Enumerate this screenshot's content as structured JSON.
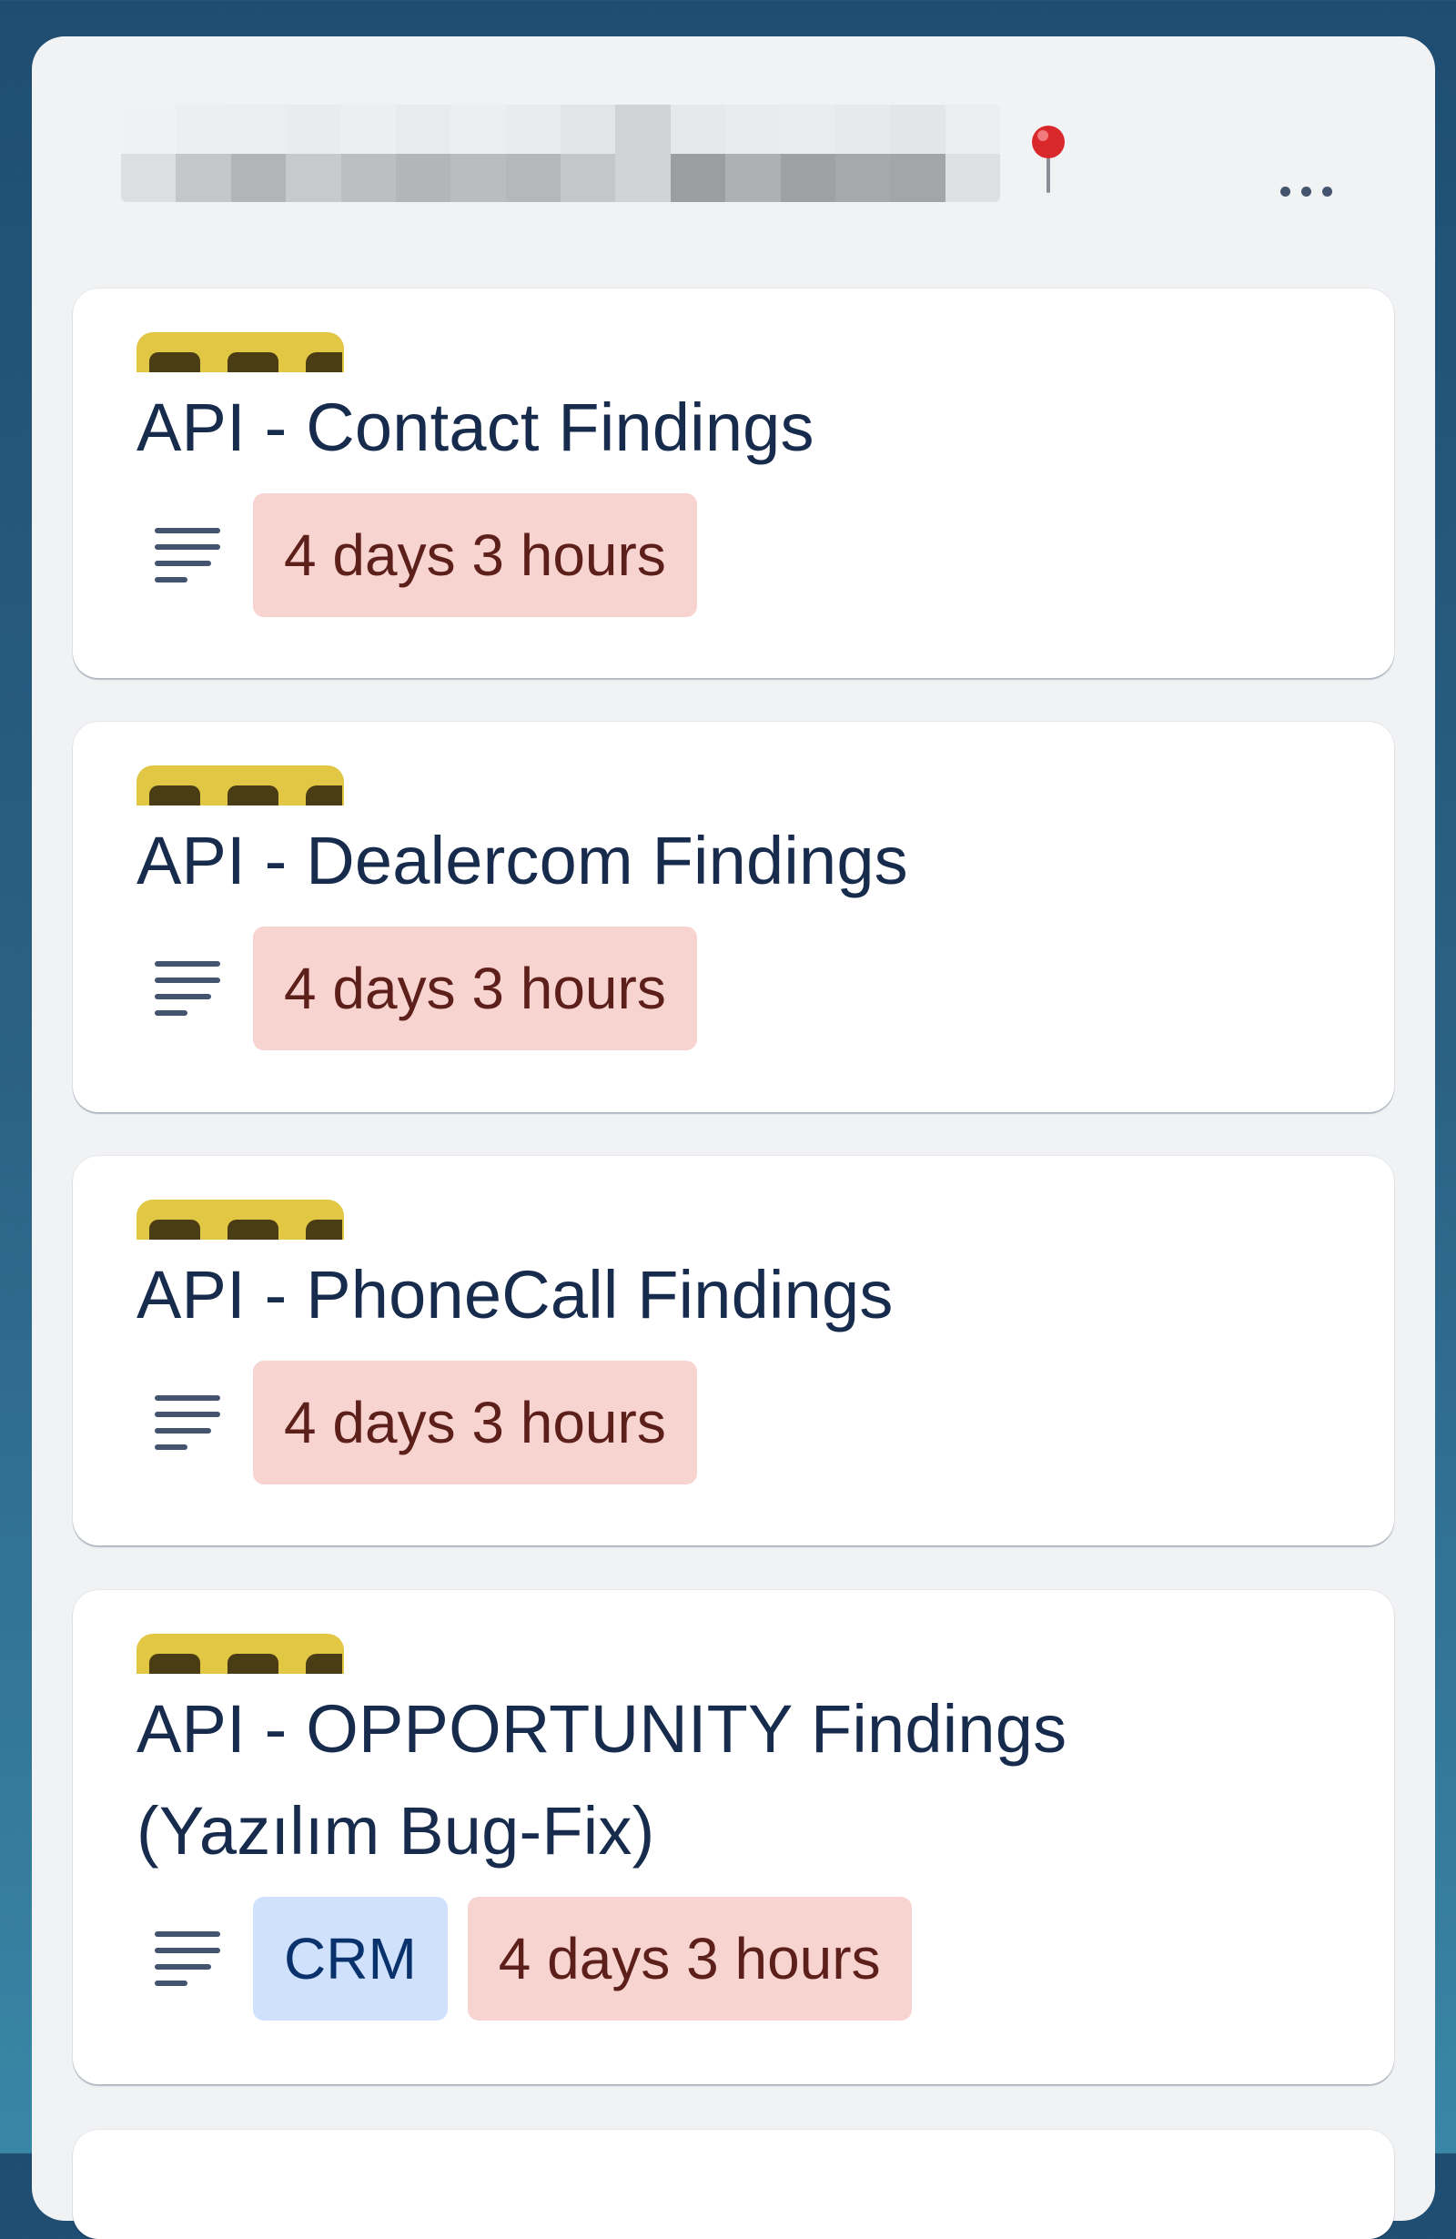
{
  "list": {
    "title_redacted": true,
    "menu_icon": "more-horizontal-icon",
    "pin_icon": "pin-icon"
  },
  "colors": {
    "label_yellow": "#e2c744",
    "due_badge_bg": "#f8d4d1",
    "due_badge_text": "#5d1f1a",
    "crm_badge_bg": "#cfe1fd",
    "crm_badge_text": "#09326c",
    "card_title": "#172b4d"
  },
  "cards": [
    {
      "title": "API - Contact Findings",
      "due": "4 days 3 hours"
    },
    {
      "title": "API - Dealercom Findings",
      "due": "4 days 3 hours"
    },
    {
      "title": "API - PhoneCall Findings",
      "due": "4 days 3 hours"
    },
    {
      "title_line1": "API - OPPORTUNITY Findings",
      "title_line2": "(Yazılım Bug-Fix)",
      "tag": "CRM",
      "due": "4 days 3 hours"
    }
  ]
}
